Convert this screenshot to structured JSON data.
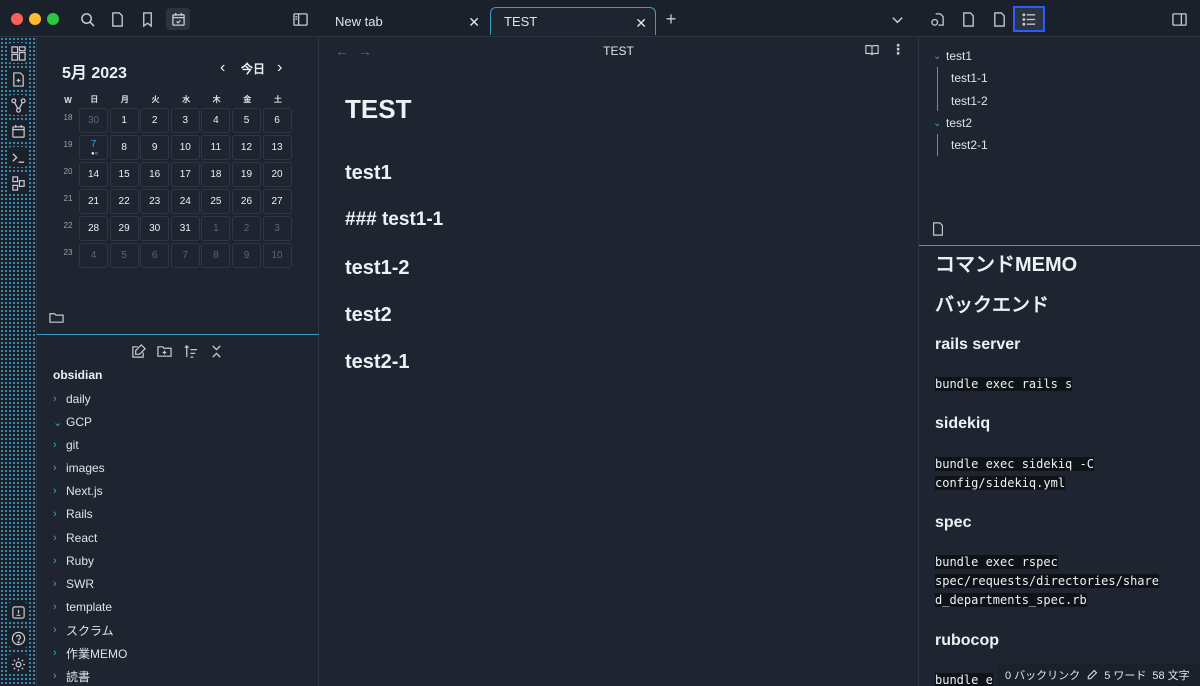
{
  "tabs": [
    {
      "label": "New tab"
    },
    {
      "label": "TEST"
    }
  ],
  "calendar": {
    "title": "5月 2023",
    "today_label": "今日",
    "weekdays": [
      "W",
      "日",
      "月",
      "火",
      "水",
      "木",
      "金",
      "土"
    ],
    "weeks": [
      {
        "wk": "18",
        "days": [
          "30",
          "1",
          "2",
          "3",
          "4",
          "5",
          "6"
        ]
      },
      {
        "wk": "19",
        "days": [
          "7",
          "8",
          "9",
          "10",
          "11",
          "12",
          "13"
        ]
      },
      {
        "wk": "20",
        "days": [
          "14",
          "15",
          "16",
          "17",
          "18",
          "19",
          "20"
        ]
      },
      {
        "wk": "21",
        "days": [
          "21",
          "22",
          "23",
          "24",
          "25",
          "26",
          "27"
        ]
      },
      {
        "wk": "22",
        "days": [
          "28",
          "29",
          "30",
          "31",
          "1",
          "2",
          "3"
        ]
      },
      {
        "wk": "23",
        "days": [
          "4",
          "5",
          "6",
          "7",
          "8",
          "9",
          "10"
        ]
      }
    ]
  },
  "file_explorer": {
    "vault": "obsidian",
    "folders": [
      "daily",
      "GCP",
      "git",
      "images",
      "Next.js",
      "Rails",
      "React",
      "Ruby",
      "SWR",
      "template",
      "スクラム",
      "作業MEMO",
      "読書"
    ]
  },
  "editor": {
    "view_title": "TEST",
    "doc_title": "TEST",
    "headings": [
      "test1",
      "### test1-1",
      "test1-2",
      "test2",
      "test2-1"
    ]
  },
  "outline": {
    "items": [
      {
        "label": "test1",
        "level": 1
      },
      {
        "label": "test1-1",
        "level": 2
      },
      {
        "label": "test1-2",
        "level": 2
      },
      {
        "label": "test2",
        "level": 1
      },
      {
        "label": "test2-1",
        "level": 2
      }
    ]
  },
  "memo": {
    "title": "コマンドMEMO",
    "section": "バックエンド",
    "blocks": [
      {
        "heading": "rails server",
        "code": [
          "bundle exec rails s"
        ]
      },
      {
        "heading": "sidekiq",
        "code": [
          "bundle exec sidekiq -C ",
          "config/sidekiq.yml"
        ]
      },
      {
        "heading": "spec",
        "code": [
          "bundle exec rspec ",
          "spec/requests/directories/share",
          "d_departments_spec.rb"
        ]
      },
      {
        "heading": "rubocop",
        "code": [
          "bundle e"
        ]
      }
    ]
  },
  "status": {
    "backlinks": "0 バックリンク",
    "words": "5 ワード",
    "chars": "58 文字"
  },
  "colors": {
    "accent": "#3aa6d4",
    "highlight_box": "#2d5bff"
  }
}
